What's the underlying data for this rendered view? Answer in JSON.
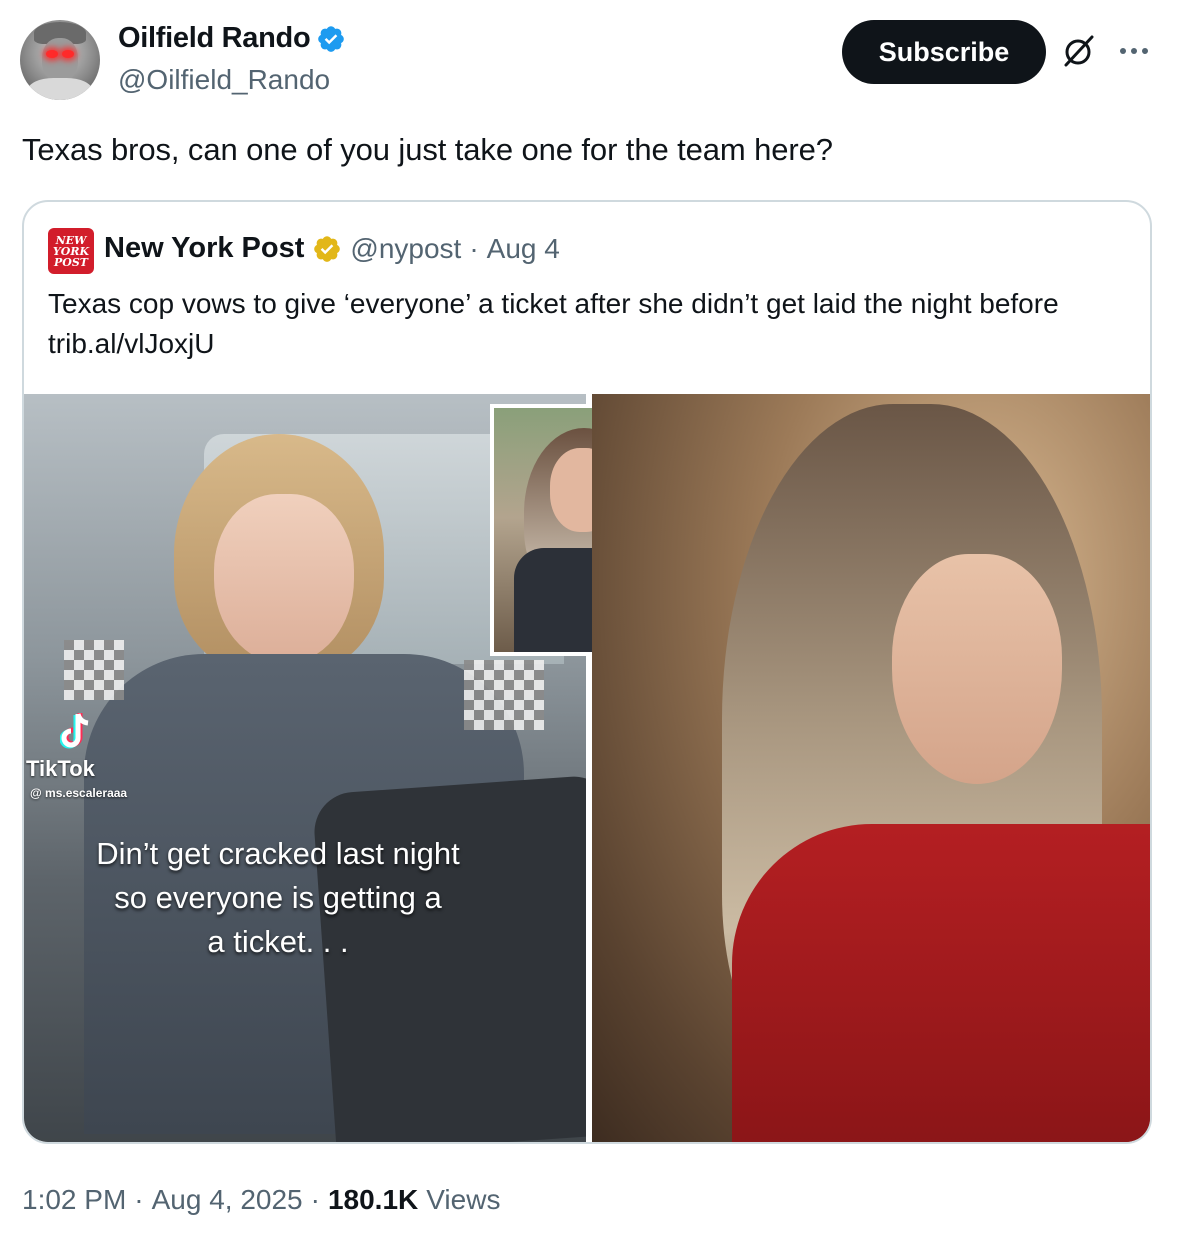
{
  "author": {
    "display_name": "Oilfield Rando",
    "handle": "@Oilfield_Rando"
  },
  "actions": {
    "subscribe_label": "Subscribe"
  },
  "tweet": {
    "text": "Texas bros, can one of you just take one for the team here?"
  },
  "quote": {
    "logo_text": [
      "NEW",
      "YORK",
      "POST"
    ],
    "display_name": "New York Post",
    "handle": "@nypost",
    "separator": "·",
    "date": "Aug 4",
    "text": "Texas cop vows to give ‘everyone’ a ticket after she didn’t get laid the night before trib.al/vlJoxjU",
    "media": {
      "left_image": {
        "watermark_brand": "TikTok",
        "watermark_user": "@ ms.escaleraaa",
        "caption": "Din’t get cracked last night\nso everyone is getting a\na ticket. . ."
      }
    }
  },
  "footer": {
    "time": "1:02 PM",
    "sep1": "·",
    "date": "Aug 4, 2025",
    "sep2": "·",
    "views_count": "180.1K",
    "views_label": "Views"
  },
  "colors": {
    "text_primary": "#0f1419",
    "text_secondary": "#536471",
    "verified_blue": "#1d9bf0",
    "verified_gold": "#e2b719",
    "nypost_red": "#d21d2b",
    "border": "#cfd9de"
  },
  "icons": {
    "verified": "verified-badge-icon",
    "grok": "grok-icon",
    "more": "more-icon",
    "tiktok": "tiktok-icon"
  }
}
